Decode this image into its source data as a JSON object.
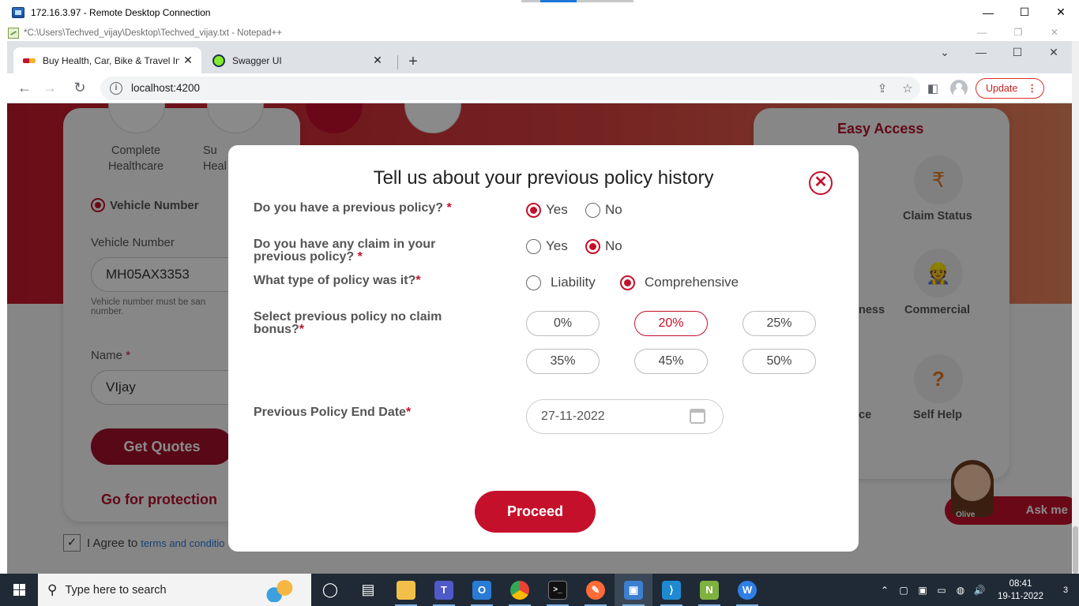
{
  "rdp": {
    "title": "172.16.3.97 - Remote Desktop Connection",
    "minimize": "—",
    "maximize": "☐",
    "close": "✕"
  },
  "notepad": {
    "title": "*C:\\Users\\Techved_vijay\\Desktop\\Techved_vijay.txt - Notepad++",
    "minimize": "—",
    "restore": "❐",
    "close": "✕"
  },
  "browser": {
    "tabs": [
      {
        "title": "Buy Health, Car, Bike & Travel Ins",
        "close": "✕"
      },
      {
        "title": "Swagger UI",
        "close": "✕"
      }
    ],
    "new_tab": "+",
    "tab_menu": "⌄",
    "min": "—",
    "max": "☐",
    "close": "✕",
    "back": "←",
    "forward": "→",
    "reload": "↻",
    "url": "localhost:4200",
    "info_glyph": "i",
    "share_glyph": "⇪",
    "star_glyph": "☆",
    "sidepanel_glyph": "◧",
    "update_label": "Update",
    "menu_dots": "⋮"
  },
  "background": {
    "products": [
      {
        "label": "Complete\nHealthcare"
      },
      {
        "label": "Su\nHeal"
      }
    ],
    "radio_vehicle_label": "Vehicle Number",
    "vehicle_number_label": "Vehicle Number",
    "vehicle_number_value": "MH05AX3353",
    "vehicle_hint": "Vehicle number must be san\nnumber.",
    "name_label": "Name",
    "name_required": "*",
    "name_value": "VIjay",
    "get_quotes": "Get Quotes",
    "protection_text": "Go for protection",
    "agree_check": "✓",
    "agree_text": "I Agree to",
    "agree_link": "terms and conditio",
    "easy_access_title": "Easy Access",
    "easy_items": [
      {
        "label": "Claim Status",
        "icon": "rupee-bag-icon",
        "glyph": "₹"
      },
      {
        "label": "Commercial",
        "icon": "worker-icon",
        "glyph": "👷"
      },
      {
        "label": "Self Help",
        "icon": "help-hand-icon",
        "glyph": "?"
      }
    ],
    "partial_labels": [
      "ness",
      "ce"
    ],
    "chat_name": "Olive",
    "chat_label": "Ask me"
  },
  "modal": {
    "title": "Tell us about your previous policy history",
    "close_glyph": "✕",
    "q1": {
      "text": "Do you have a previous policy?",
      "req": "*",
      "options": [
        "Yes",
        "No"
      ],
      "selected": "Yes"
    },
    "q2": {
      "text": "Do you have any claim in your previous policy?",
      "req": "*",
      "options": [
        "Yes",
        "No"
      ],
      "selected": "No"
    },
    "q3": {
      "text": "What type of policy was it?",
      "req": "*",
      "options": [
        "Liability",
        "Comprehensive"
      ],
      "selected": "Comprehensive"
    },
    "q4": {
      "text": "Select previous policy no claim bonus?",
      "req": "*",
      "options": [
        "0%",
        "20%",
        "25%",
        "35%",
        "45%",
        "50%"
      ],
      "selected": "20%"
    },
    "q5": {
      "text": "Previous Policy End Date",
      "req": "*",
      "value": "27-11-2022"
    },
    "proceed": "Proceed"
  },
  "taskbar": {
    "search_placeholder": "Type here to search",
    "search_glyph": "⚲",
    "apps": [
      {
        "name": "task-view",
        "glyph": "◯",
        "color": "transparent"
      },
      {
        "name": "widgets",
        "glyph": "▤",
        "color": "transparent"
      },
      {
        "name": "file-explorer",
        "glyph": "",
        "color": "#f2c04a"
      },
      {
        "name": "teams",
        "glyph": "T",
        "color": "#5059c9"
      },
      {
        "name": "outlook",
        "glyph": "O",
        "color": "#2a7bd3"
      },
      {
        "name": "chrome",
        "glyph": "",
        "color": "#ea4335"
      },
      {
        "name": "terminal",
        "glyph": ">_",
        "color": "#111"
      },
      {
        "name": "postman",
        "glyph": "✎",
        "color": "#ff6c37"
      },
      {
        "name": "remote-desktop",
        "glyph": "▣",
        "color": "#3b7fd0"
      },
      {
        "name": "vscode",
        "glyph": "⟩",
        "color": "#1f8ad2"
      },
      {
        "name": "notepadpp",
        "glyph": "N",
        "color": "#7fb241"
      },
      {
        "name": "wps",
        "glyph": "W",
        "color": "#2f7fe6"
      }
    ],
    "tray_up": "⌃",
    "tray_network": "◍",
    "tray_volume": "🔊",
    "time": "08:41",
    "date": "19-11-2022",
    "notifications": "3"
  }
}
